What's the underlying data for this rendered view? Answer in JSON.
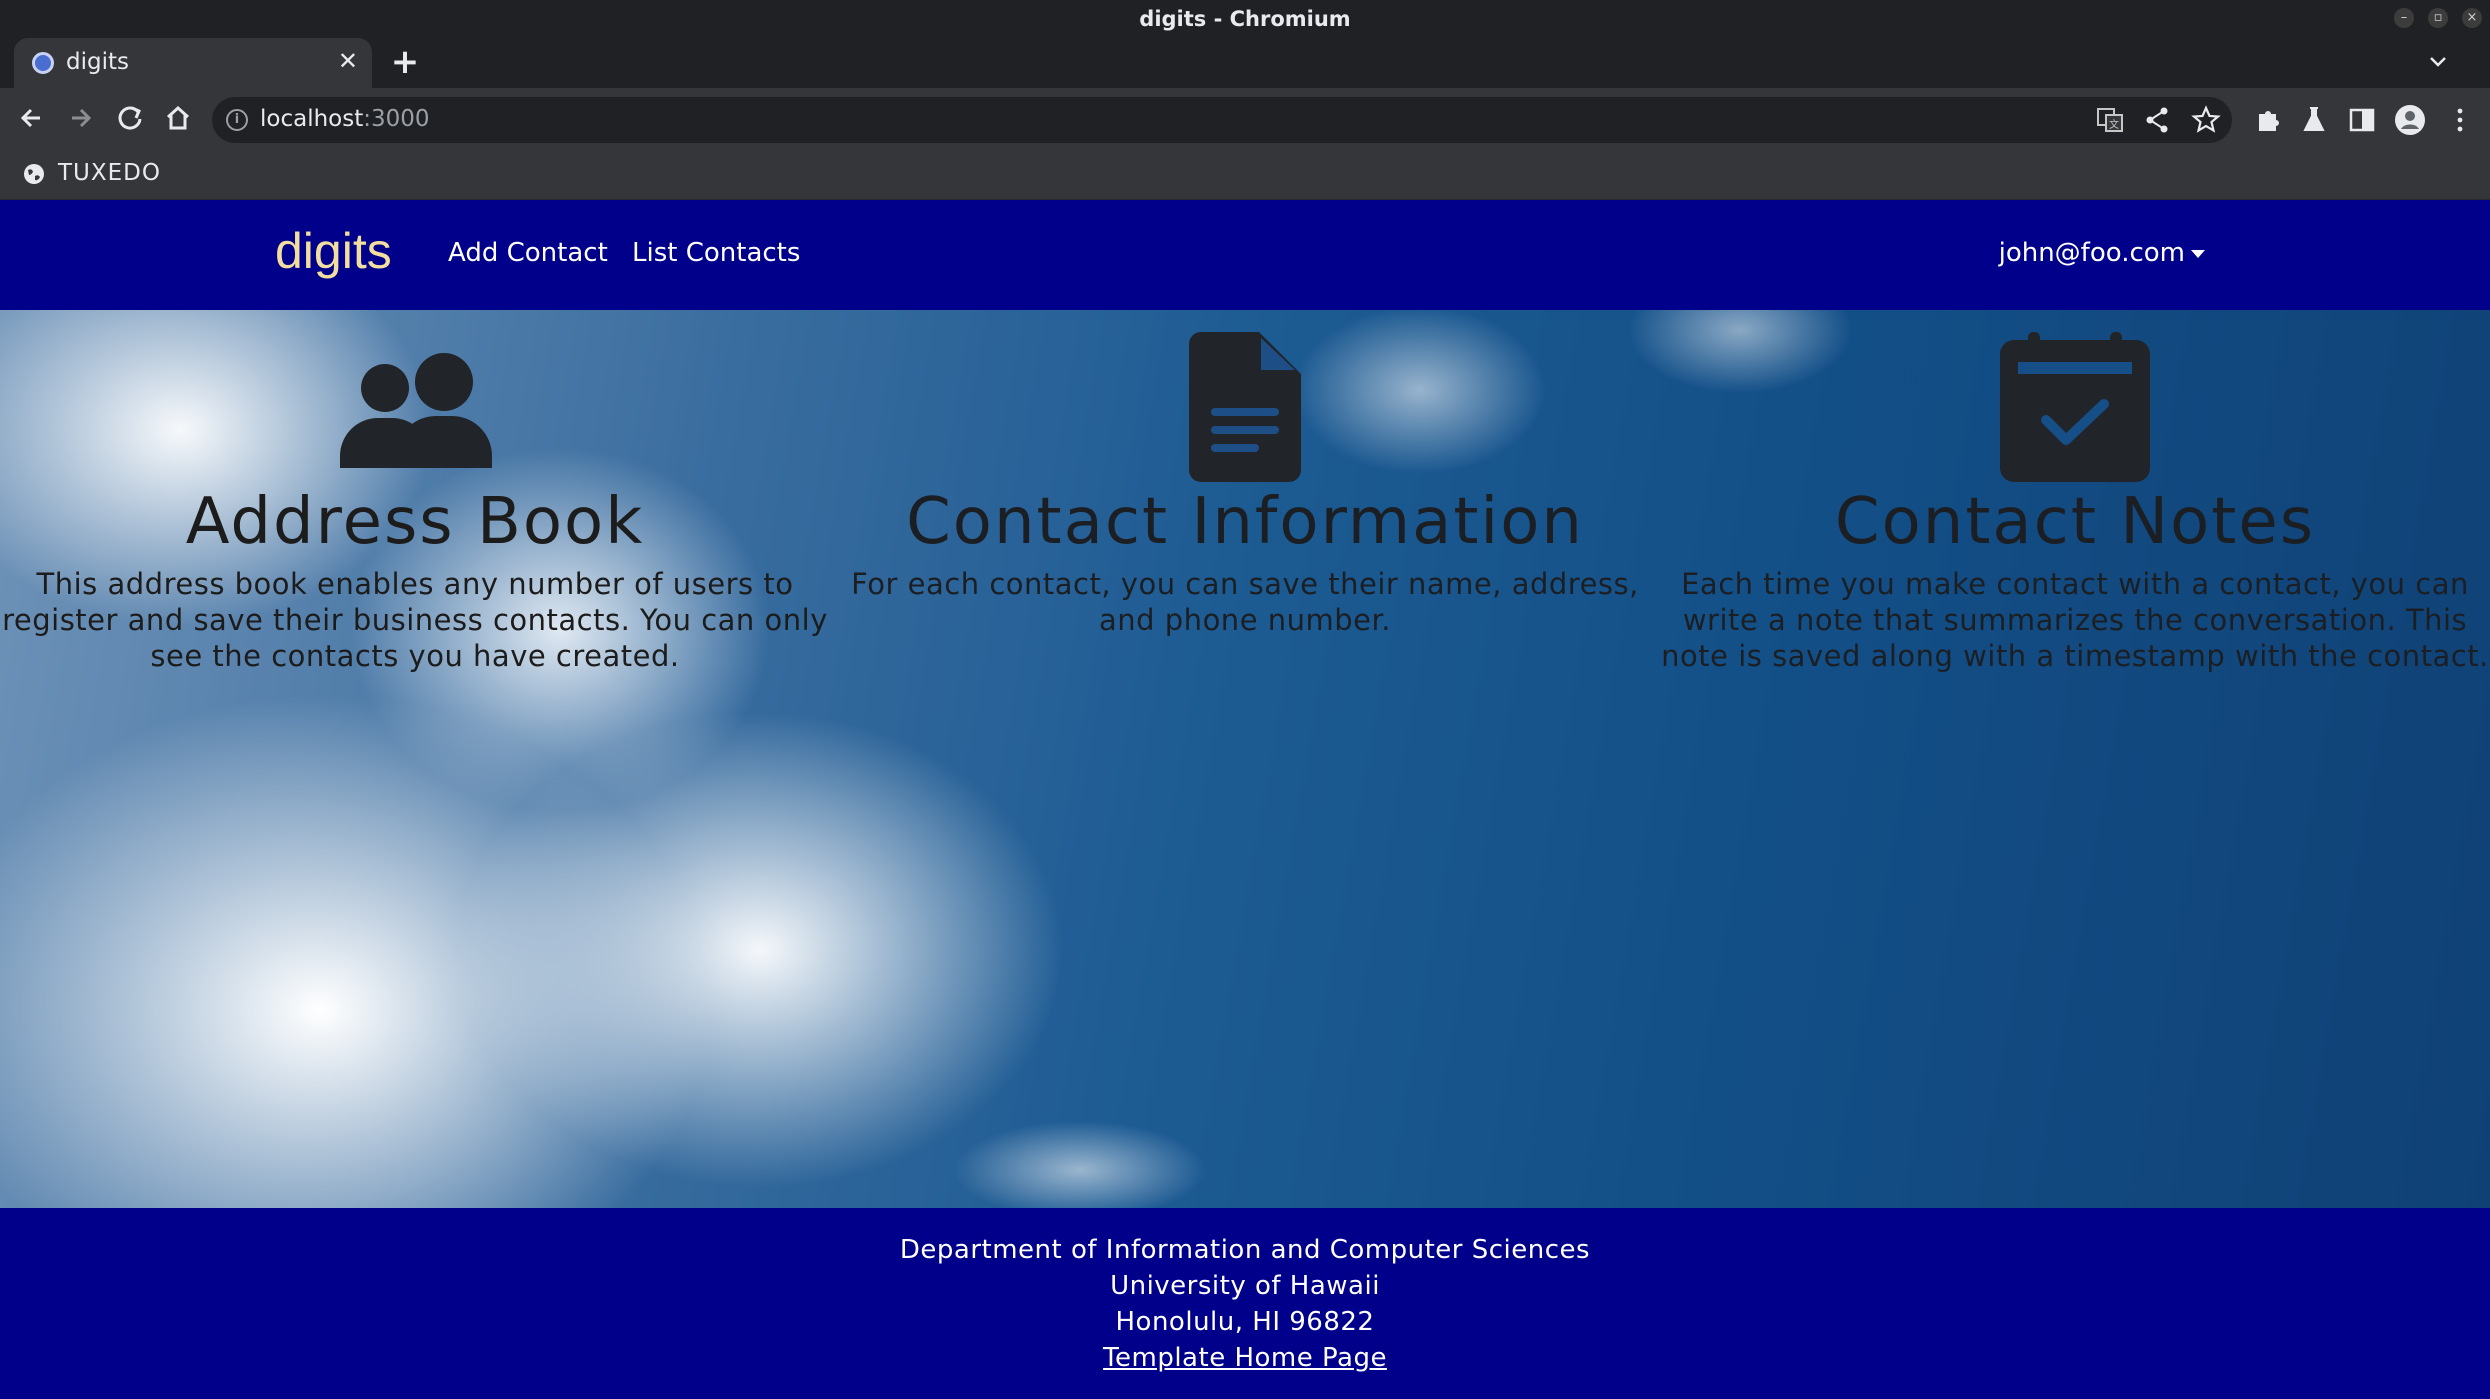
{
  "window": {
    "title": "digits - Chromium"
  },
  "tab": {
    "title": "digits"
  },
  "address_bar": {
    "host": "localhost",
    "port": ":3000"
  },
  "bookmarks": {
    "items": [
      "TUXEDO"
    ]
  },
  "navbar": {
    "brand": "digits",
    "links": [
      "Add Contact",
      "List Contacts"
    ],
    "user": "john@foo.com"
  },
  "features": [
    {
      "icon": "users-icon",
      "title": "Address Book",
      "text": "This address book enables any number of users to register and save their business contacts. You can only see the contacts you have created."
    },
    {
      "icon": "file-lines-icon",
      "title": "Contact Information",
      "text": "For each contact, you can save their name, address, and phone number."
    },
    {
      "icon": "calendar-check-icon",
      "title": "Contact Notes",
      "text": "Each time you make contact with a contact, you can write a note that summarizes the conversation. This note is saved along with a timestamp with the contact."
    }
  ],
  "footer": {
    "lines": [
      "Department of Information and Computer Sciences",
      "University of Hawaii",
      "Honolulu, HI 96822"
    ],
    "link": "Template Home Page"
  },
  "colors": {
    "navbar": "#00008b",
    "brand": "#f2dfa0",
    "icon": "#212529"
  }
}
